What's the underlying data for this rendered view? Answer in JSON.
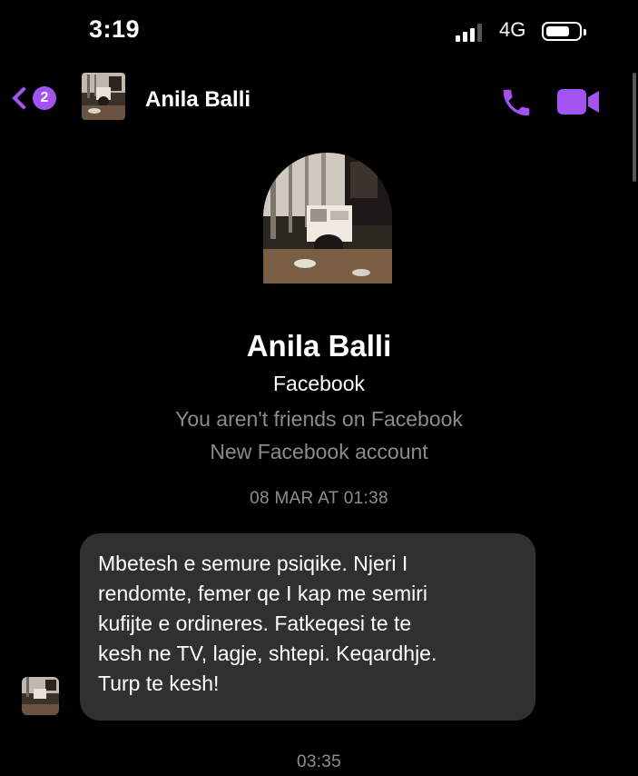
{
  "status_bar": {
    "time": "3:19",
    "network": "4G",
    "battery_level": 0.7
  },
  "header": {
    "unread_count": "2",
    "contact_name": "Anila Balli",
    "icons": [
      "back-chevron-icon",
      "phone-icon",
      "video-camera-icon"
    ]
  },
  "profile": {
    "name": "Anila Balli",
    "platform": "Facebook",
    "friend_status": "You aren't friends on Facebook",
    "account_note": "New Facebook account"
  },
  "thread": {
    "first_timestamp": "08 MAR AT 01:38",
    "message": {
      "lines": [
        "Mbetesh e semure psiqike. Njeri I",
        "rendomte, femer qe I kap me semiri",
        "kufijte e ordineres. Fatkeqesi te te",
        "kesh ne TV, lagje, shtepi. Keqardhje.",
        "Turp te kesh!"
      ]
    },
    "second_timestamp": "03:35"
  },
  "colors": {
    "accent": "#a353ef",
    "background": "#000000",
    "bubble": "#303030",
    "muted_text": "#8b8b8b"
  }
}
